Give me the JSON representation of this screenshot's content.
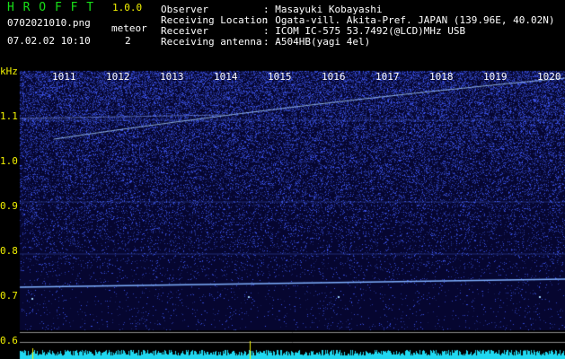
{
  "app": {
    "name": "H R O F F T",
    "version": "1.0.0"
  },
  "file": {
    "name": "0702021010.png",
    "datetime": "07.02.02 10:10"
  },
  "meteor": {
    "label": "meteor",
    "count": "2"
  },
  "info": [
    {
      "key": "Observer",
      "value": ": Masayuki Kobayashi"
    },
    {
      "key": "Receiving Location",
      "value": ": Ogata-vill. Akita-Pref. JAPAN (139.96E, 40.02N)"
    },
    {
      "key": "Receiver",
      "value": ": ICOM IC-575 53.7492(@LCD)MHz USB"
    },
    {
      "key": "Receiving antenna",
      "value": ": A504HB(yagi 4el)"
    }
  ],
  "y_axis": {
    "unit": "kHz",
    "ticks": [
      "1.1",
      "1.0",
      "0.9",
      "0.8",
      "0.7",
      "0.6"
    ]
  },
  "x_axis": {
    "ticks": [
      "1011",
      "1012",
      "1013",
      "1014",
      "1015",
      "1016",
      "1017",
      "1018",
      "1019",
      "1020"
    ]
  },
  "colors": {
    "background": "#000000",
    "spectrogram": "#0a0a50",
    "noise": "#4060ff",
    "signal": "#9fd4ff",
    "power_trace": "#20e0ff"
  }
}
